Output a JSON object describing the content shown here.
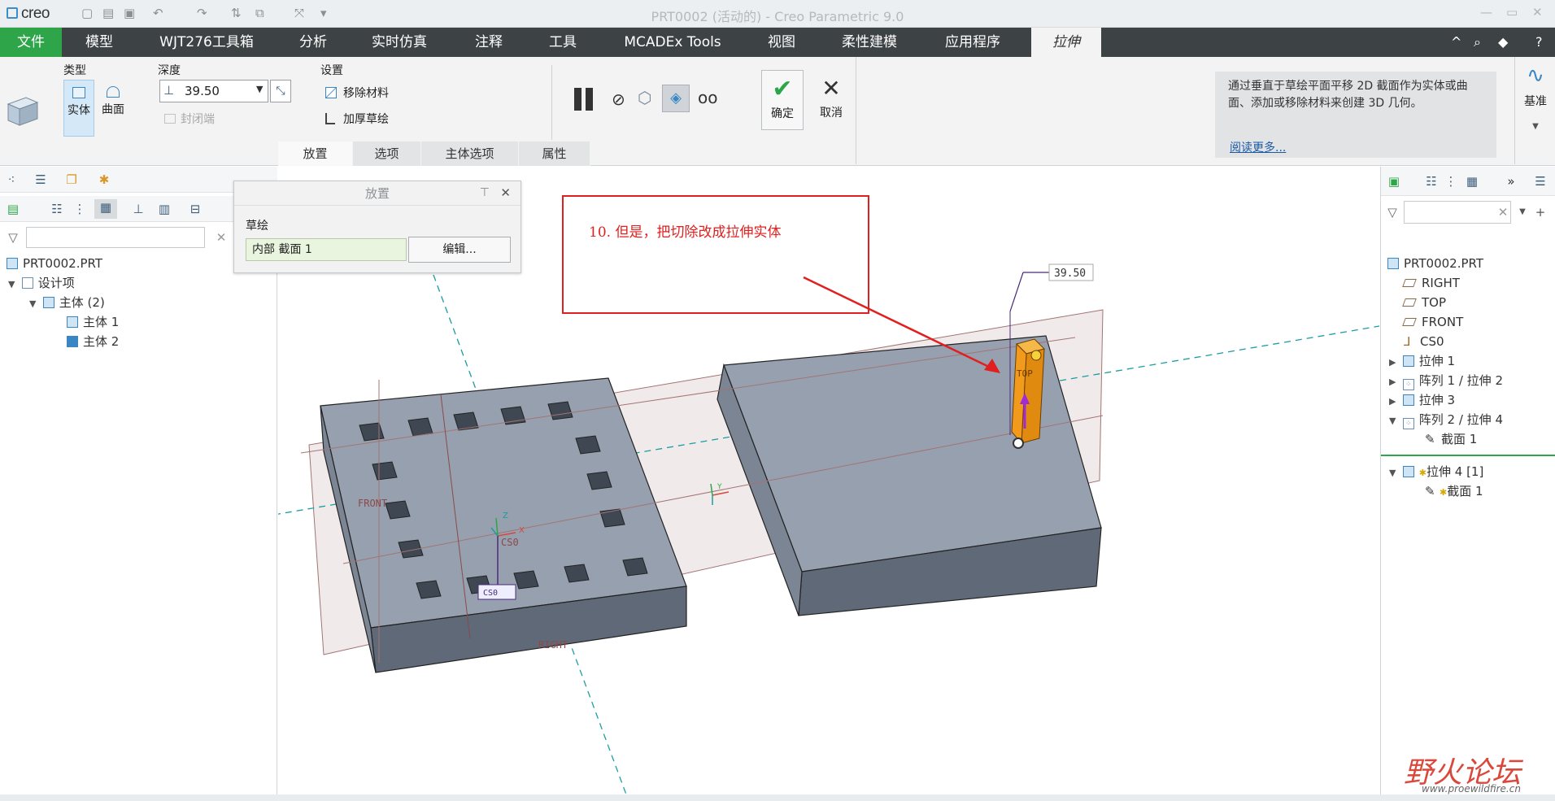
{
  "app": {
    "logo": "creo",
    "title": "PRT0002 (活动的) - Creo Parametric 9.0",
    "window_controls": [
      "—",
      "▭",
      "✕"
    ]
  },
  "menu": {
    "items": [
      "文件",
      "模型",
      "WJT276工具箱",
      "分析",
      "实时仿真",
      "注释",
      "工具",
      "MCADEx Tools",
      "视图",
      "柔性建模",
      "应用程序",
      "拉伸"
    ],
    "right_icons": [
      "^",
      "⌕",
      "◆",
      "?"
    ]
  },
  "ribbon": {
    "type_label": "类型",
    "solid_label": "实体",
    "surface_label": "曲面",
    "depth_label": "深度",
    "depth_value": "39.50",
    "capped_ends_label": "封闭端",
    "settings_label": "设置",
    "remove_material_label": "移除材料",
    "thicken_sketch_label": "加厚草绘",
    "ok_label": "确定",
    "cancel_label": "取消",
    "datum_label": "基准",
    "tabs": [
      "放置",
      "选项",
      "主体选项",
      "属性"
    ],
    "help_text": "通过垂直于草绘平面平移 2D 截面作为实体或曲面、添加或移除材料来创建 3D 几何。",
    "help_link": "阅读更多..."
  },
  "left_tree": {
    "items": [
      {
        "label": "PRT0002.PRT"
      },
      {
        "label": "设计项"
      },
      {
        "label": "主体 (2)"
      },
      {
        "label": "主体 1"
      },
      {
        "label": "主体 2"
      }
    ]
  },
  "placement_dialog": {
    "title": "放置",
    "sketch_label": "草绘",
    "collector_value": "内部 截面 1",
    "edit_button": "编辑..."
  },
  "graphics": {
    "annotation_text": "10. 但是，把切除改成拉伸实体",
    "dimension_value": "39.50",
    "labels": {
      "front": "FRONT",
      "right": "RIGHT",
      "top": "TOP",
      "cs0": "CS0",
      "cs0_small": "CS0",
      "axis_x": "X",
      "axis_y": "Y",
      "axis_z": "Z"
    }
  },
  "right_tree": {
    "items": [
      {
        "label": "PRT0002.PRT"
      },
      {
        "label": "RIGHT"
      },
      {
        "label": "TOP"
      },
      {
        "label": "FRONT"
      },
      {
        "label": "CS0"
      },
      {
        "label": "拉伸 1"
      },
      {
        "label": "阵列 1 / 拉伸 2"
      },
      {
        "label": "拉伸 3"
      },
      {
        "label": "阵列 2 / 拉伸 4"
      },
      {
        "label": "截面 1"
      },
      {
        "label": "拉伸 4 [1]"
      },
      {
        "label": "截面 1"
      }
    ]
  },
  "watermark": {
    "site_name": "野火论坛",
    "url": "www.proewildfire.cn"
  },
  "colors": {
    "menu_bg": "#3d4245",
    "file_green": "#2fa54a",
    "annotation_red": "#e02020",
    "feature_orange": "#f29a1c",
    "body_gray": "#8e98a6",
    "datum_plane": "#b07a7a"
  }
}
